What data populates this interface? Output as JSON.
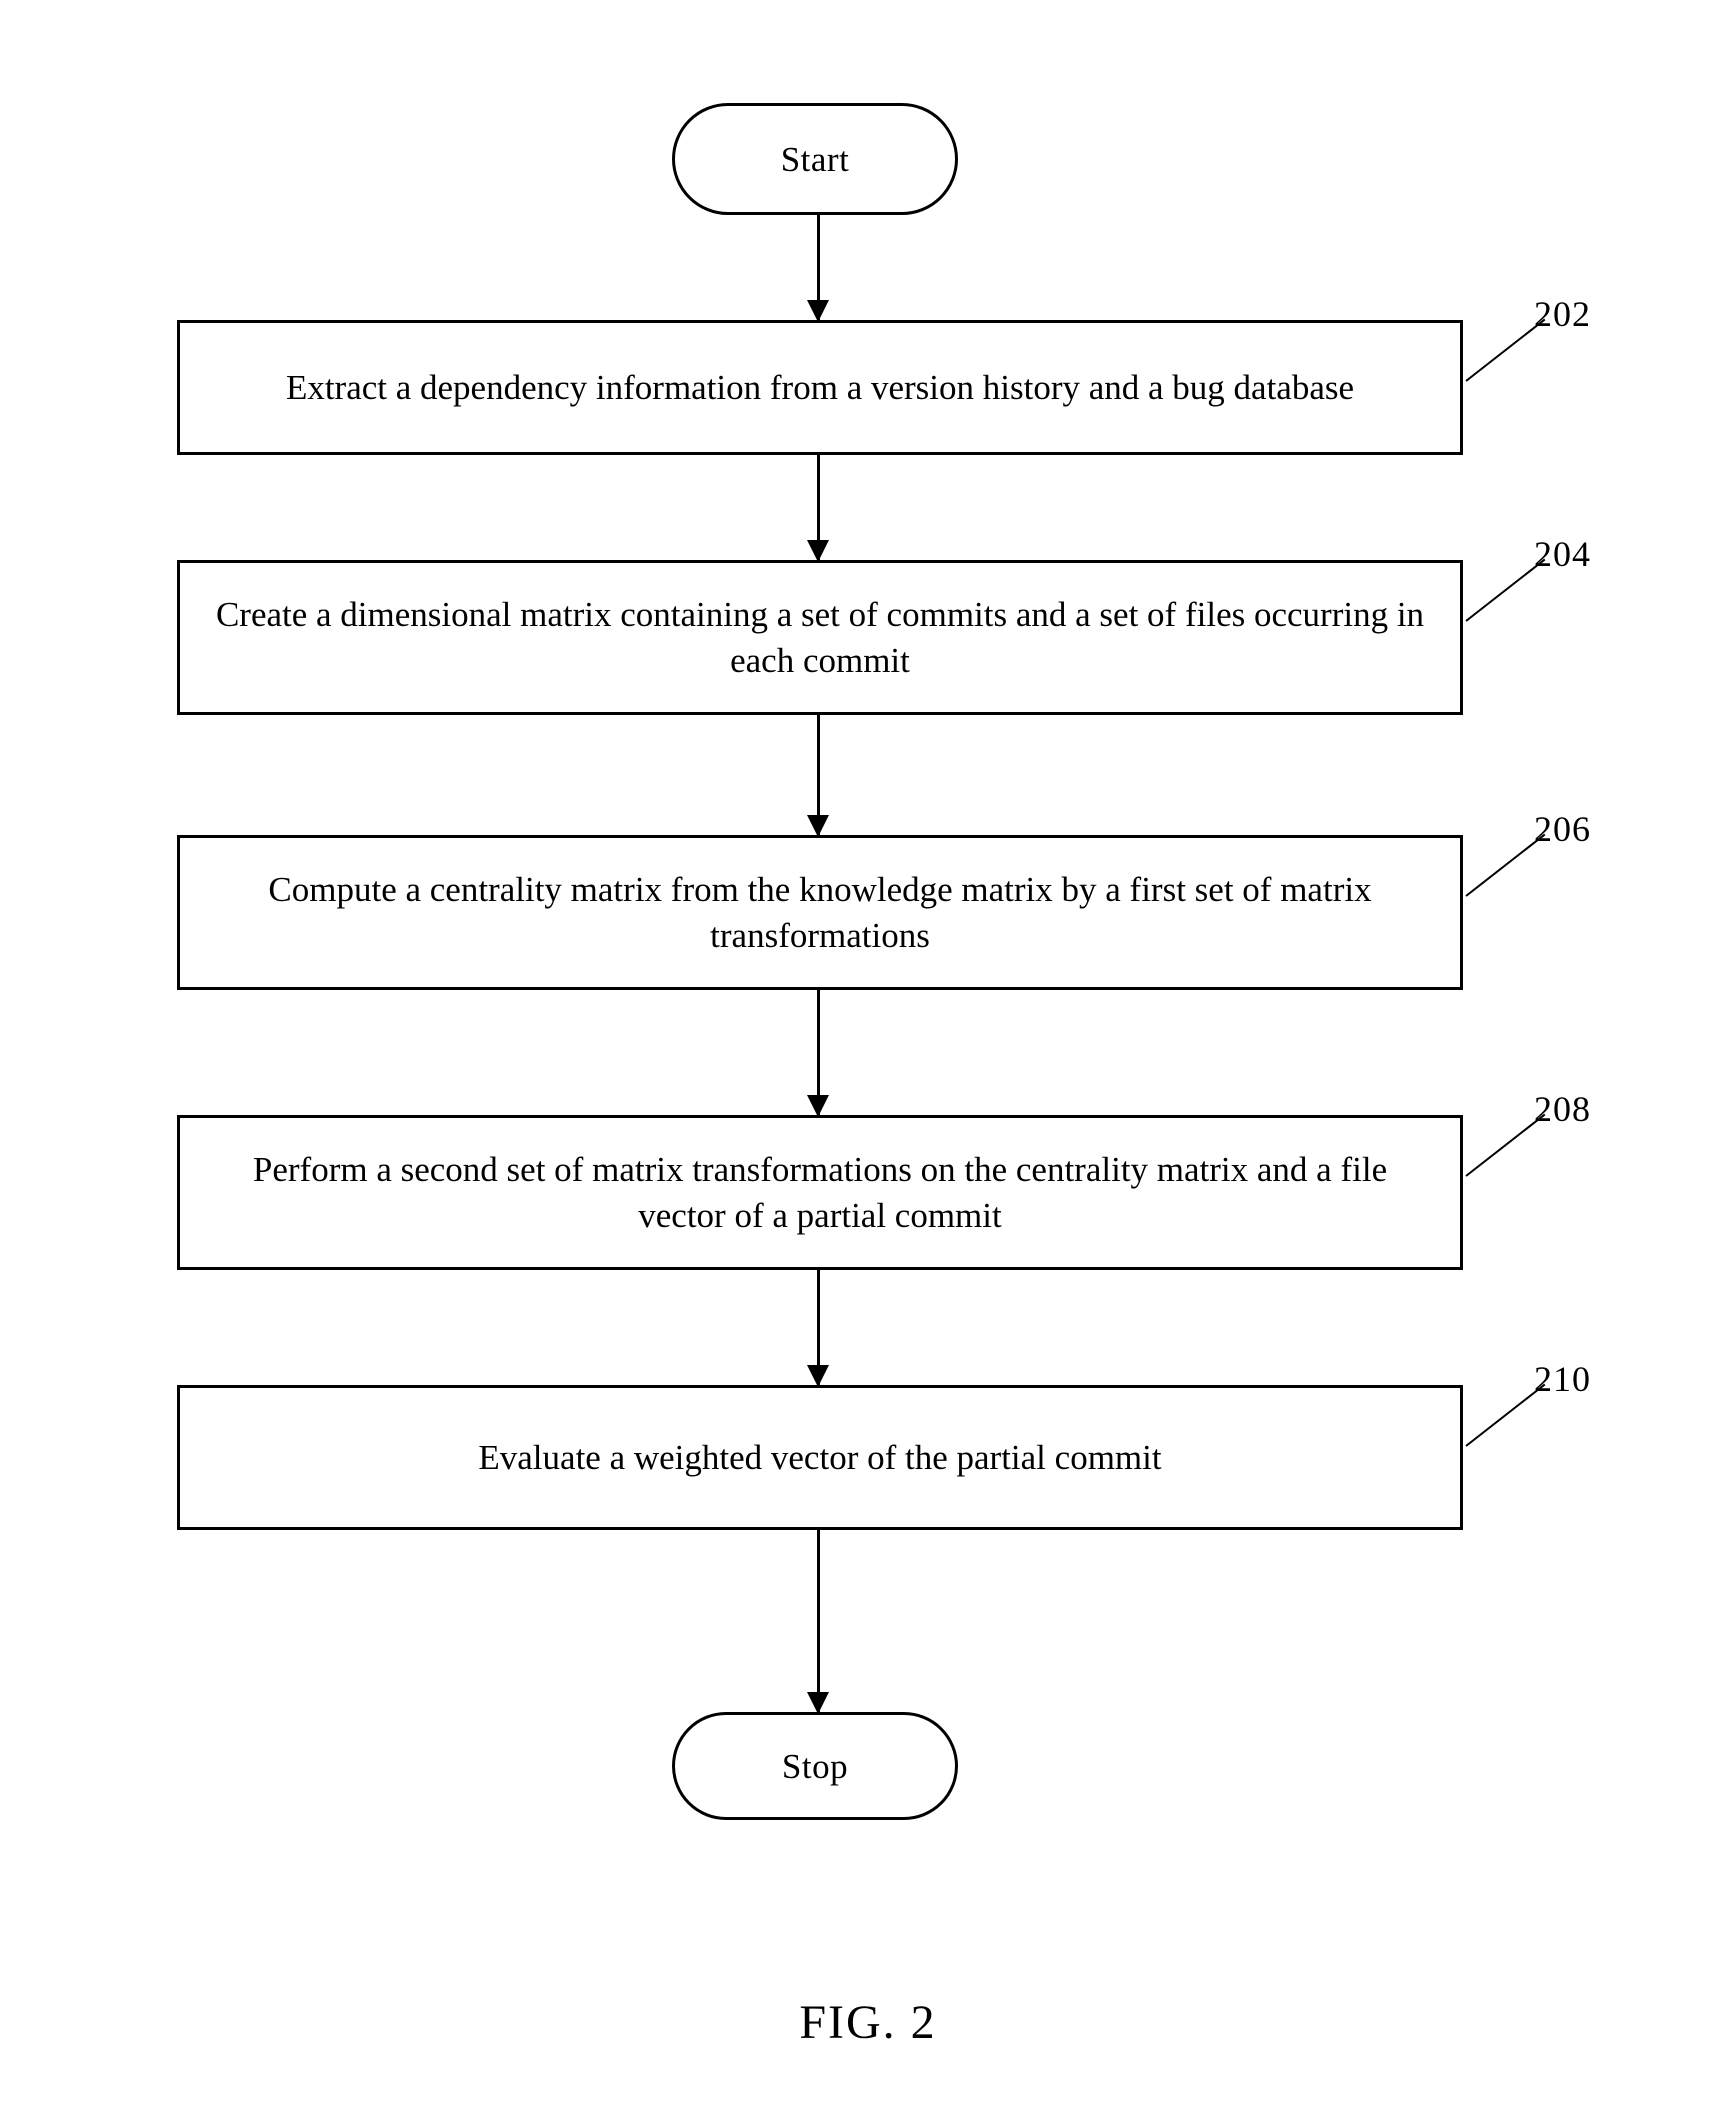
{
  "figure": {
    "caption": "FIG. 2"
  },
  "nodes": {
    "start": {
      "label": "Start",
      "type": "terminator"
    },
    "stop": {
      "label": "Stop",
      "type": "terminator"
    },
    "steps": [
      {
        "ref": "202",
        "text": "Extract a dependency information from a version history and a bug database"
      },
      {
        "ref": "204",
        "text": "Create a dimensional matrix containing a set of commits and a set of files occurring in each commit"
      },
      {
        "ref": "206",
        "text": "Compute a centrality matrix from the knowledge matrix by a first set of matrix transformations"
      },
      {
        "ref": "208",
        "text": "Perform a second set of matrix transformations on the centrality matrix and a file vector of a partial commit"
      },
      {
        "ref": "210",
        "text": "Evaluate a weighted vector of the partial commit"
      }
    ]
  },
  "style": {
    "stroke_color": "#000000",
    "background_color": "#ffffff"
  }
}
